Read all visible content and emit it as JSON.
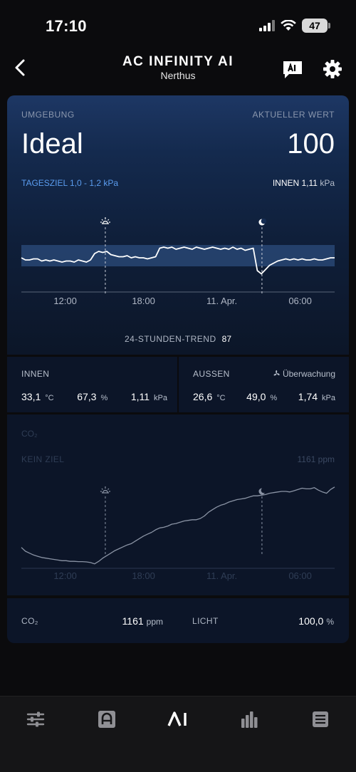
{
  "status_bar": {
    "time": "17:10",
    "battery": "47"
  },
  "header": {
    "title": "AC INFINITY AI",
    "subtitle": "Nerthus"
  },
  "environment": {
    "label": "UMGEBUNG",
    "status": "Ideal",
    "current_label": "AKTUELLER WERT",
    "current_value": "100",
    "target_label": "TAGESZIEL 1,0 - 1,2 kPa",
    "inside_prefix": "INNEN",
    "inside_value": "1,11",
    "inside_unit": "kPa",
    "trend_label": "24-STUNDEN-TREND",
    "trend_value": "87"
  },
  "sensors": {
    "inside": {
      "title": "INNEN",
      "temp": "33,1",
      "temp_unit": "°C",
      "humidity": "67,3",
      "humidity_unit": "%",
      "vpd": "1,11",
      "vpd_unit": "kPa"
    },
    "outside": {
      "title": "AUSSEN",
      "monitor_label": "Überwachung",
      "temp": "26,6",
      "temp_unit": "°C",
      "humidity": "49,0",
      "humidity_unit": "%",
      "vpd": "1,74",
      "vpd_unit": "kPa"
    }
  },
  "co2": {
    "title": "CO₂",
    "no_target": "KEIN ZIEL",
    "reading": "1161 ppm"
  },
  "bottom": {
    "co2_label": "CO₂",
    "co2_value": "1161",
    "co2_unit": "ppm",
    "light_label": "LICHT",
    "light_value": "100,0",
    "light_unit": "%"
  },
  "chart_data": [
    {
      "type": "line",
      "title": "",
      "xlabel": "",
      "ylabel": "",
      "x_ticks": [
        "12:00",
        "18:00",
        "11. Apr.",
        "06:00"
      ],
      "target_band": [
        1.0,
        1.2
      ],
      "ylim": [
        0.8,
        1.4
      ],
      "markers": [
        "sunrise",
        "moon"
      ],
      "series": [
        {
          "values": [
            1.08,
            1.06,
            1.06,
            1.07,
            1.07,
            1.05,
            1.06,
            1.05,
            1.06,
            1.05,
            1.04,
            1.05,
            1.05,
            1.04,
            1.06,
            1.05,
            1.04,
            1.06,
            1.12,
            1.14,
            1.13,
            1.14,
            1.11,
            1.1,
            1.09,
            1.09,
            1.1,
            1.08,
            1.09,
            1.08,
            1.08,
            1.07,
            1.08,
            1.09,
            1.17,
            1.18,
            1.17,
            1.18,
            1.16,
            1.17,
            1.18,
            1.17,
            1.16,
            1.18,
            1.17,
            1.16,
            1.17,
            1.18,
            1.17,
            1.16,
            1.17,
            1.16,
            1.18,
            1.16,
            1.17,
            1.15,
            1.16,
            1.17,
            0.96,
            0.93,
            0.97,
            1.01,
            1.03,
            1.05,
            1.06,
            1.07,
            1.06,
            1.07,
            1.06,
            1.07,
            1.06,
            1.06,
            1.07,
            1.06,
            1.06,
            1.07,
            1.08,
            1.08
          ]
        }
      ]
    },
    {
      "type": "line",
      "title": "CO₂",
      "xlabel": "",
      "ylabel": "",
      "x_ticks": [
        "12:00",
        "18:00",
        "11. Apr.",
        "06:00"
      ],
      "ylim": [
        0,
        1300
      ],
      "markers": [
        "sunrise",
        "moon"
      ],
      "series": [
        {
          "values": [
            320,
            260,
            230,
            200,
            180,
            160,
            150,
            140,
            130,
            120,
            110,
            110,
            100,
            100,
            95,
            95,
            90,
            80,
            60,
            100,
            150,
            190,
            230,
            270,
            300,
            330,
            360,
            380,
            420,
            460,
            500,
            530,
            560,
            600,
            630,
            640,
            660,
            690,
            700,
            720,
            740,
            750,
            760,
            760,
            780,
            820,
            880,
            920,
            960,
            990,
            1010,
            1040,
            1060,
            1080,
            1090,
            1100,
            1120,
            1140,
            1140,
            1150,
            1160,
            1180,
            1190,
            1200,
            1210,
            1210,
            1200,
            1220,
            1240,
            1260,
            1250,
            1250,
            1270,
            1230,
            1200,
            1180,
            1240,
            1280
          ]
        }
      ]
    }
  ]
}
